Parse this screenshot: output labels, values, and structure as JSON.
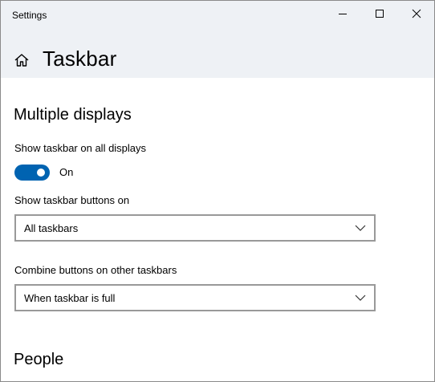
{
  "window": {
    "app_title": "Settings",
    "minimize_icon": "minimize-icon",
    "maximize_icon": "maximize-icon",
    "close_icon": "close-icon"
  },
  "header": {
    "home_icon": "home-icon",
    "page_title": "Taskbar"
  },
  "sections": [
    {
      "heading": "Multiple displays",
      "show_on_all_label": "Show taskbar on all displays",
      "toggle_state": "On",
      "toggle_on": true,
      "buttons_on_label": "Show taskbar buttons on",
      "buttons_on_value": "All taskbars",
      "combine_label": "Combine buttons on other taskbars",
      "combine_value": "When taskbar is full"
    },
    {
      "heading": "People"
    }
  ],
  "colors": {
    "accent": "#0063b1",
    "header_bg": "#eef1f5",
    "dropdown_border": "#999999"
  }
}
